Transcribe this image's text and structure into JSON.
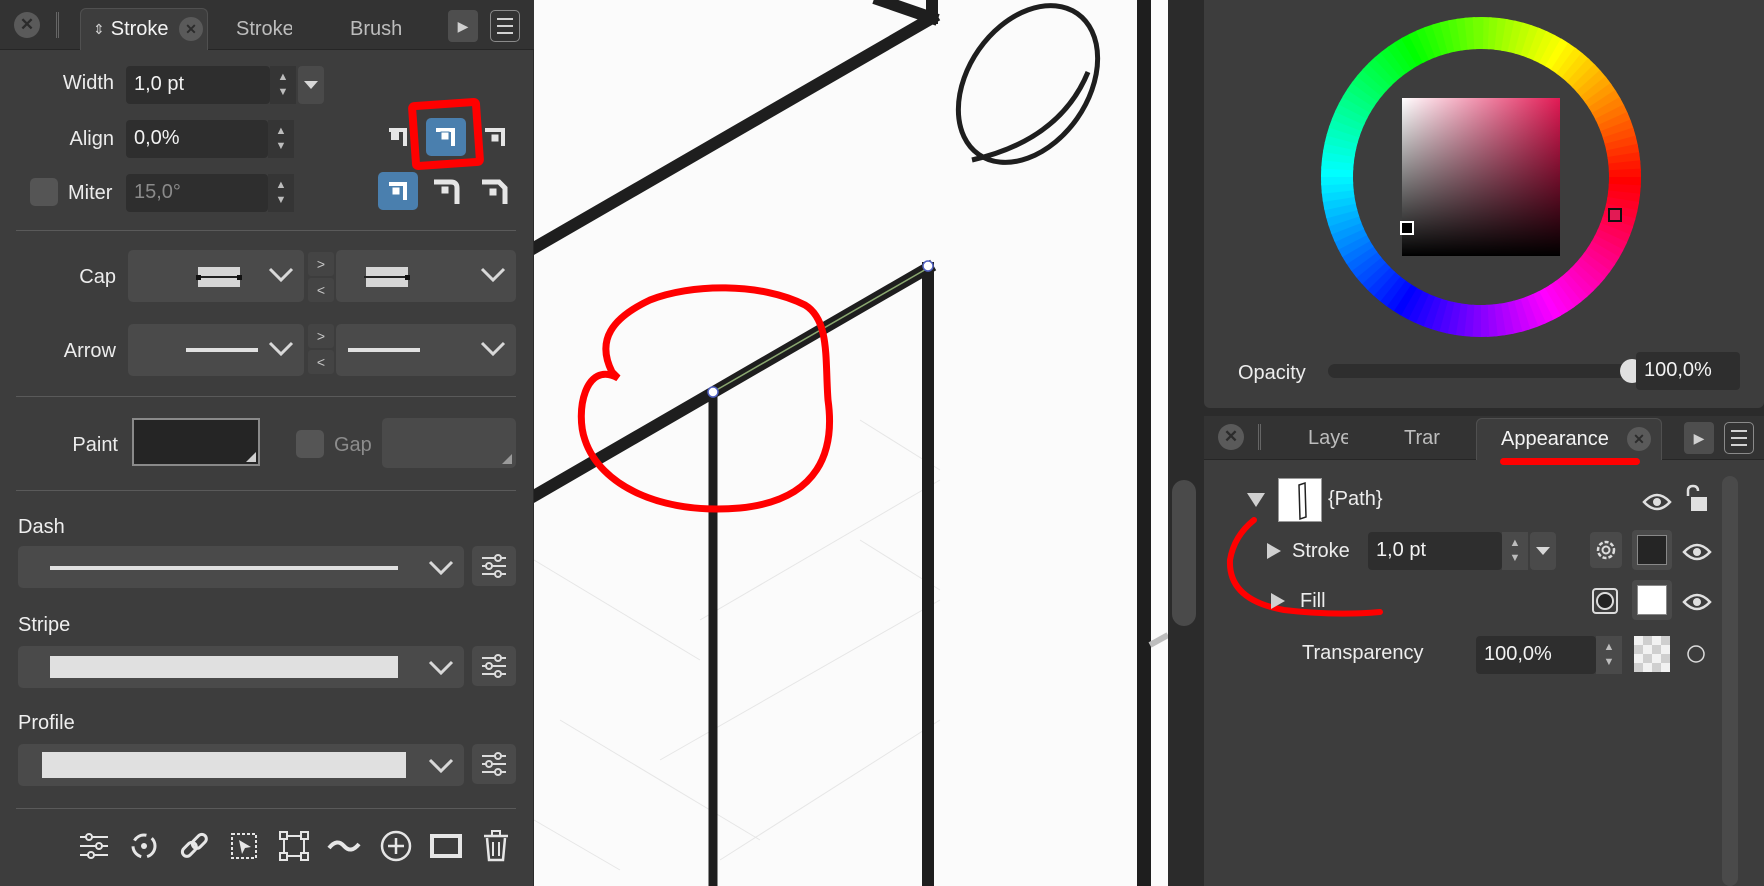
{
  "left_panel": {
    "tabs": [
      {
        "label": "Stroke",
        "active": true
      },
      {
        "label": "Stroke",
        "active": false
      },
      {
        "label": "Brush",
        "active": false
      }
    ],
    "width": {
      "label": "Width",
      "value": "1,0 pt"
    },
    "align": {
      "label": "Align",
      "value": "0,0%"
    },
    "miter": {
      "label": "Miter",
      "value": "15,0°"
    },
    "cap": {
      "label": "Cap"
    },
    "arrow": {
      "label": "Arrow"
    },
    "paint": {
      "label": "Paint"
    },
    "gap": {
      "label": "Gap"
    },
    "dash": {
      "label": "Dash"
    },
    "stripe": {
      "label": "Stripe"
    },
    "profile": {
      "label": "Profile"
    },
    "tools": [
      "sliders-icon",
      "rotate-icon",
      "link-icon",
      "select-icon",
      "transform-icon",
      "wave-icon",
      "add-icon",
      "rectangle-icon",
      "trash-icon"
    ]
  },
  "color_panel": {
    "opacity_label": "Opacity",
    "opacity_value": "100,0%",
    "opacity_level": 1.0
  },
  "appearance_panel": {
    "tabs": [
      {
        "label": "Laye",
        "active": false
      },
      {
        "label": "Trar",
        "active": false
      },
      {
        "label": "Appearance",
        "active": true
      }
    ],
    "object": "{Path}",
    "stroke": {
      "label": "Stroke",
      "value": "1,0 pt"
    },
    "fill": {
      "label": "Fill"
    },
    "transparency": {
      "label": "Transparency",
      "value": "100,0%"
    }
  },
  "colors": {
    "panel_bg": "#3d3d3d",
    "accent": "#4a7fae",
    "annotation_red": "#ff0000"
  }
}
